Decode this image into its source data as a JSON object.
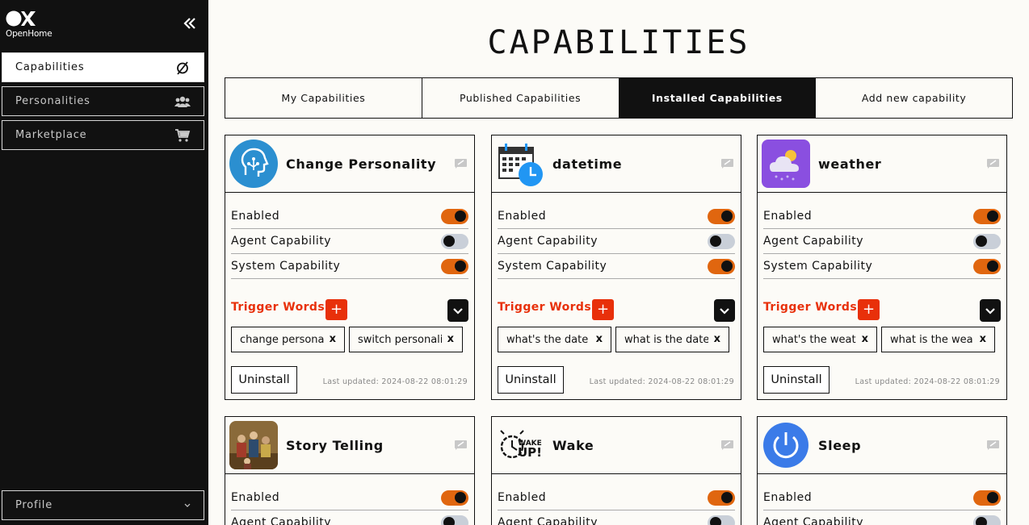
{
  "sidebar": {
    "logo_text": "OpenHome",
    "items": [
      {
        "label": "Capabilities"
      },
      {
        "label": "Personalities"
      },
      {
        "label": "Marketplace"
      }
    ],
    "profile_label": "Profile"
  },
  "page_title": "CAPABILITIES",
  "tabs": [
    {
      "label": "My Capabilities"
    },
    {
      "label": "Published Capabilities"
    },
    {
      "label": "Installed Capabilities"
    },
    {
      "label": "Add new capability"
    }
  ],
  "labels": {
    "enabled": "Enabled",
    "agent": "Agent Capability",
    "system": "System Capability",
    "trigger": "Trigger Words",
    "uninstall": "Uninstall",
    "plus": "+",
    "remove": "x"
  },
  "colors": {
    "accent": "#e0660f",
    "trigger": "#e8300a"
  },
  "cards": [
    {
      "name": "Change Personality",
      "icon": "ai-head-icon",
      "enabled": true,
      "agent": false,
      "system": true,
      "triggers": [
        "change persona",
        "switch personali"
      ],
      "updated": "Last updated: 2024-08-22 08:01:29"
    },
    {
      "name": "datetime",
      "icon": "calendar-clock-icon",
      "enabled": true,
      "agent": false,
      "system": true,
      "triggers": [
        "what's the date",
        "what is the date"
      ],
      "updated": "Last updated: 2024-08-22 08:01:29"
    },
    {
      "name": "weather",
      "icon": "weather-cloud-icon",
      "enabled": true,
      "agent": false,
      "system": true,
      "triggers": [
        "what's the weat",
        "what is the wea"
      ],
      "updated": "Last updated: 2024-08-22 08:01:29"
    },
    {
      "name": "Story Telling",
      "icon": "story-painting-icon",
      "enabled": true,
      "agent": false
    },
    {
      "name": "Wake",
      "icon": "wake-up-icon",
      "enabled": true,
      "agent": false
    },
    {
      "name": "Sleep",
      "icon": "power-icon",
      "enabled": true,
      "agent": false
    }
  ]
}
